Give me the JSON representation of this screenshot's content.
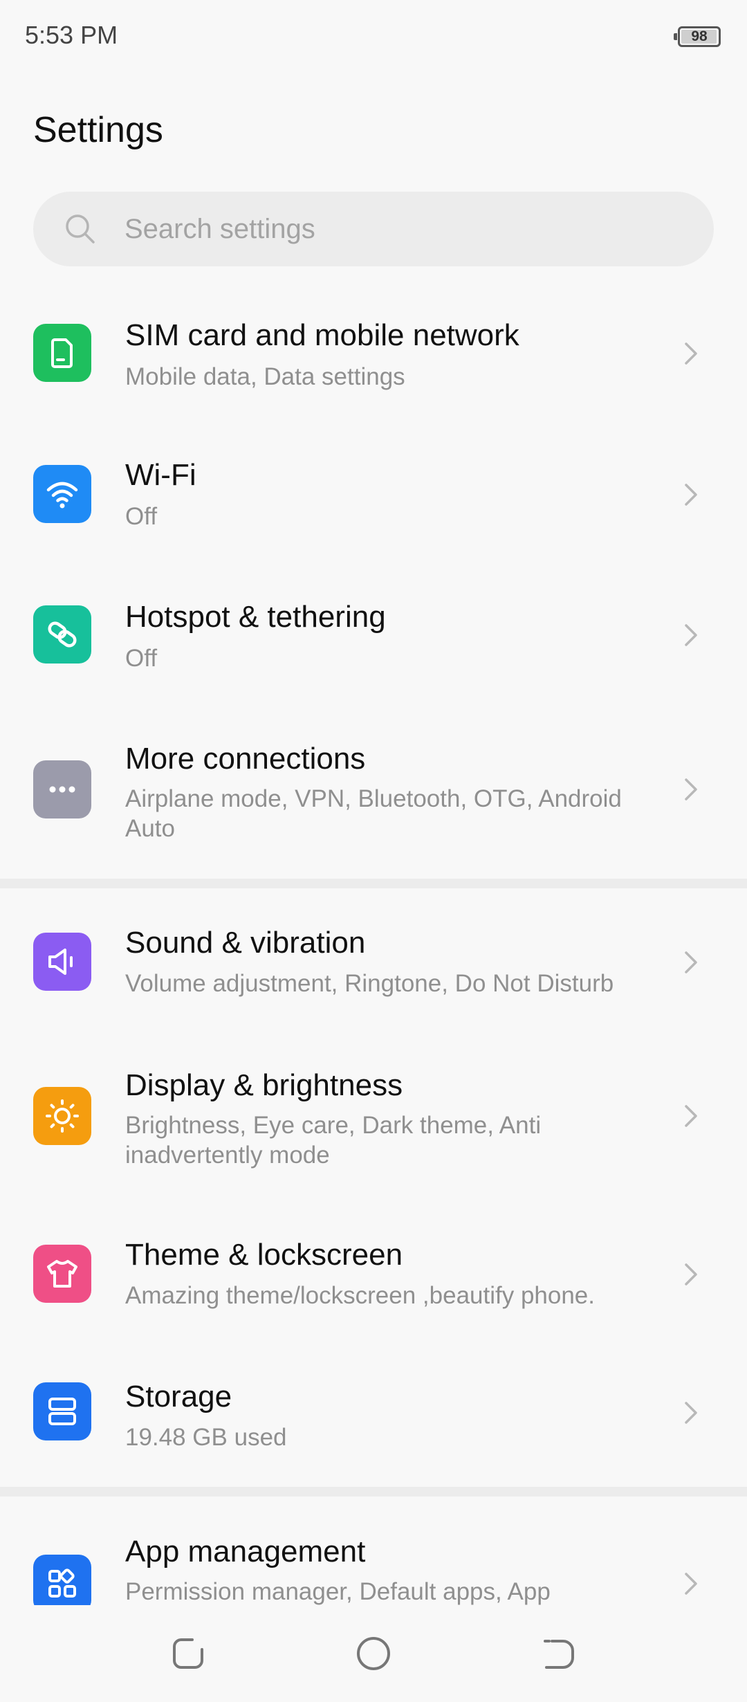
{
  "status_bar": {
    "time": "5:53 PM",
    "battery_level": "98",
    "battery_fraction": 0.98
  },
  "header": {
    "title": "Settings"
  },
  "search": {
    "placeholder": "Search settings",
    "value": ""
  },
  "settings": {
    "items": [
      {
        "title": "SIM card and mobile network",
        "subtitle": "Mobile data, Data settings",
        "icon": "sim-card-icon",
        "color": "#1ebf5e"
      },
      {
        "title": "Wi-Fi",
        "subtitle": "Off",
        "icon": "wifi-icon",
        "color": "#1f8bf5"
      },
      {
        "title": "Hotspot & tethering",
        "subtitle": "Off",
        "icon": "hotspot-icon",
        "color": "#17c09b"
      },
      {
        "title": "More connections",
        "subtitle": "Airplane mode, VPN, Bluetooth, OTG, Android Auto",
        "icon": "more-dots-icon",
        "color": "#9b9bab"
      },
      {
        "title": "Sound & vibration",
        "subtitle": "Volume adjustment, Ringtone, Do Not Disturb",
        "icon": "speaker-icon",
        "color": "#8b5cf2"
      },
      {
        "title": "Display & brightness",
        "subtitle": "Brightness, Eye care, Dark theme, Anti inadvertently mode",
        "icon": "sun-icon",
        "color": "#f59d0f"
      },
      {
        "title": "Theme & lockscreen",
        "subtitle": "Amazing theme/lockscreen ,beautify phone.",
        "icon": "tshirt-icon",
        "color": "#ef4f86"
      },
      {
        "title": "Storage",
        "subtitle": "19.48 GB used",
        "icon": "storage-icon",
        "color": "#1f72f0"
      },
      {
        "title": "App management",
        "subtitle": "Permission manager, Default apps, App",
        "icon": "apps-grid-icon",
        "color": "#1f72f0"
      }
    ]
  },
  "navigation": {
    "recents": "recents-icon",
    "home": "home-circle-icon",
    "back": "back-icon"
  }
}
